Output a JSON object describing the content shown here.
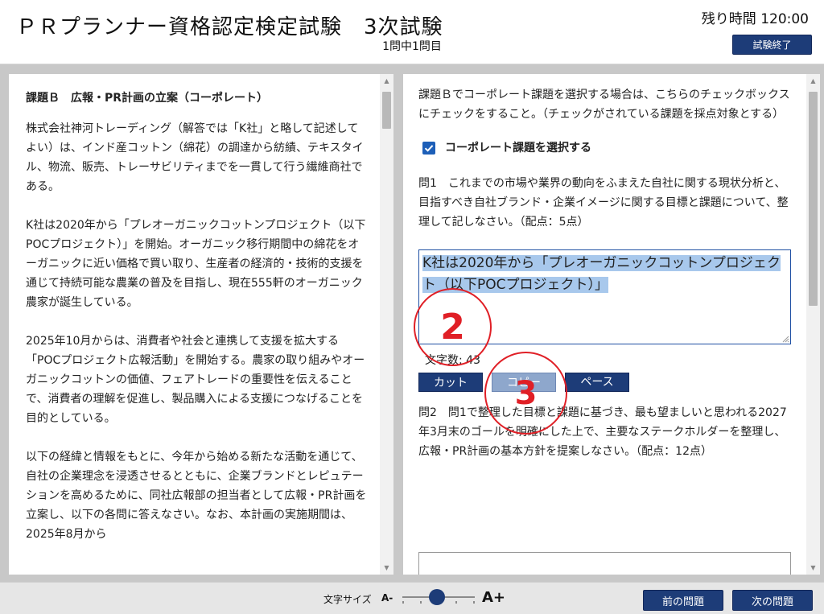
{
  "header": {
    "title": "ＰＲプランナー資格認定検定試験　3次試験",
    "counter": "1問中1問目",
    "time_label": "残り時間",
    "time_value": "120:00",
    "end_button": "試験終了"
  },
  "left_panel": {
    "case_title": "課題Ｂ　広報・PR計画の立案（コーポレート）",
    "paragraphs": [
      "株式会社神河トレーディング（解答では「K社」と略して記述してよい）は、インド産コットン（綿花）の調達から紡績、テキスタイル、物流、販売、トレーサビリティまでを一貫して行う繊維商社である。",
      "K社は2020年から「プレオーガニックコットンプロジェクト（以下POCプロジェクト）」を開始。オーガニック移行期間中の綿花をオーガニックに近い価格で買い取り、生産者の経済的・技術的支援を通じて持続可能な農業の普及を目指し、現在555軒のオーガニック農家が誕生している。",
      "2025年10月からは、消費者や社会と連携して支援を拡大する「POCプロジェクト広報活動」を開始する。農家の取り組みやオーガニックコットンの価値、フェアトレードの重要性を伝えることで、消費者の理解を促進し、製品購入による支援につなげることを目的としている。",
      "以下の経緯と情報をもとに、今年から始める新たな活動を通じて、自社の企業理念を浸透させるとともに、企業ブランドとレピュテーションを高めるために、同社広報部の担当者として広報・PR計画を立案し、以下の各問に答えなさい。なお、本計画の実施期間は、2025年8月から"
    ]
  },
  "right_panel": {
    "instruction": "課題Ｂでコーポレート課題を選択する場合は、こちらのチェックボックスにチェックをすること。（チェックがされている課題を採点対象とする）",
    "checkbox_label": "コーポレート課題を選択する",
    "q1": "問1　これまでの市場や業界の動向をふまえた自社に関する現状分析と、目指すべき自社ブランド・企業イメージに関する目標と課題について、整理して記しなさい。（配点：5点）",
    "answer1_text": "K社は2020年から「プレオーガニックコットンプロジェクト（以下POCプロジェクト）」",
    "char_count_label": "文字数: 43",
    "cut_label": "カット",
    "copy_label": "コピー",
    "paste_label": "ペースト",
    "q2": "問2　問1で整理した目標と課題に基づき、最も望ましいと思われる2027年3月末のゴールを明確にした上で、主要なステークホルダーを整理し、広報・PR計画の基本方針を提案しなさい。（配点：12点）"
  },
  "annotations": {
    "marker_2": "2",
    "marker_3": "3"
  },
  "footer": {
    "font_size_label": "文字サイズ",
    "smaller_label": "A-",
    "larger_label": "A+",
    "prev_button": "前の問題",
    "next_button": "次の問題"
  },
  "colors": {
    "primary_button": "#1d3c78",
    "selection": "#a8c8ec",
    "annotation": "#e01f26",
    "panel_bg": "#c8c8c8"
  }
}
